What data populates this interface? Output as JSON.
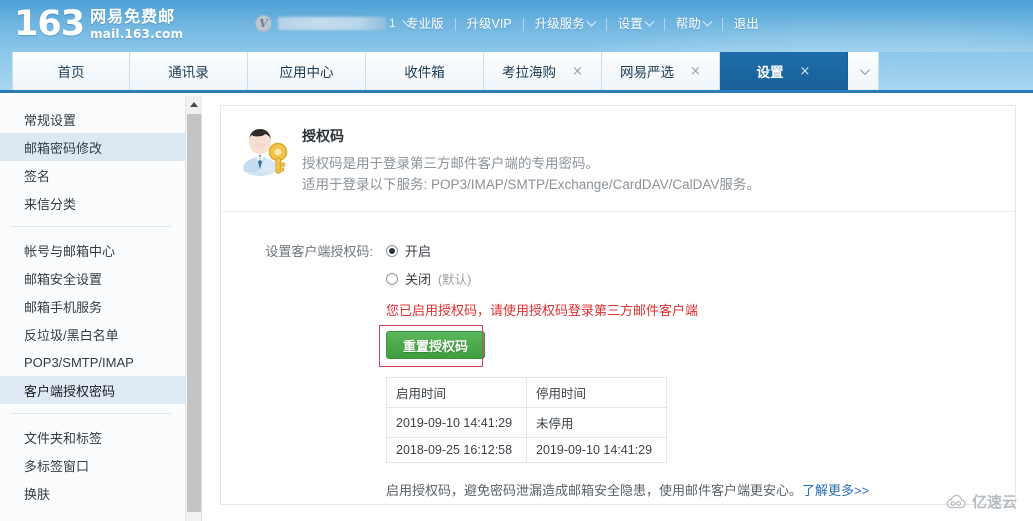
{
  "header": {
    "logo_number": "163",
    "logo_cn": "网易免费邮",
    "logo_url": "mail.163.com",
    "vip_badge": "V",
    "account_masked": "",
    "account_tail": "1",
    "nav": [
      {
        "label": "专业版",
        "has_caret": false
      },
      {
        "label": "升级VIP",
        "has_caret": false
      },
      {
        "label": "升级服务",
        "has_caret": true
      },
      {
        "label": "设置",
        "has_caret": true
      },
      {
        "label": "帮助",
        "has_caret": true
      },
      {
        "label": "退出",
        "has_caret": false
      }
    ]
  },
  "tabs": [
    {
      "label": "首页",
      "closable": false,
      "active": false
    },
    {
      "label": "通讯录",
      "closable": false,
      "active": false
    },
    {
      "label": "应用中心",
      "closable": false,
      "active": false
    },
    {
      "label": "收件箱",
      "closable": false,
      "active": false
    },
    {
      "label": "考拉海购",
      "closable": true,
      "active": false,
      "close": "×"
    },
    {
      "label": "网易严选",
      "closable": true,
      "active": false,
      "close": "×"
    },
    {
      "label": "设置",
      "closable": true,
      "active": true,
      "close": "×"
    }
  ],
  "sidebar": {
    "group1": [
      {
        "label": "常规设置",
        "state": "normal"
      },
      {
        "label": "邮箱密码修改",
        "state": "hover"
      },
      {
        "label": "签名",
        "state": "normal"
      },
      {
        "label": "来信分类",
        "state": "normal"
      }
    ],
    "group2": [
      {
        "label": "帐号与邮箱中心",
        "state": "normal"
      },
      {
        "label": "邮箱安全设置",
        "state": "normal"
      },
      {
        "label": "邮箱手机服务",
        "state": "normal"
      },
      {
        "label": "反垃圾/黑白名单",
        "state": "normal"
      },
      {
        "label": "POP3/SMTP/IMAP",
        "state": "normal"
      },
      {
        "label": "客户端授权密码",
        "state": "selected"
      }
    ],
    "group3": [
      {
        "label": "文件夹和标签",
        "state": "normal"
      },
      {
        "label": "多标签窗口",
        "state": "normal"
      },
      {
        "label": "换肤",
        "state": "normal"
      }
    ]
  },
  "main": {
    "title": "授权码",
    "desc_line1": "授权码是用于登录第三方邮件客户端的专用密码。",
    "desc_line2": "适用于登录以下服务: POP3/IMAP/SMTP/Exchange/CardDAV/CalDAV服务。",
    "form_label": "设置客户端授权码:",
    "radio_on": "开启",
    "radio_off": "关闭",
    "radio_off_note": "(默认)",
    "selected_option": "开启",
    "warning": "您已启用授权码，请使用授权码登录第三方邮件客户端",
    "reset_button": "重置授权码",
    "table": {
      "headers": [
        "启用时间",
        "停用时间"
      ],
      "rows": [
        [
          "2019-09-10 14:41:29",
          "未停用"
        ],
        [
          "2018-09-25 16:12:58",
          "2019-09-10 14:41:29"
        ]
      ]
    },
    "footer_text": "启用授权码，避免密码泄漏造成邮箱安全隐患，使用邮件客户端更安心。",
    "footer_link": "了解更多>>"
  },
  "watermark": {
    "text": "亿速云"
  },
  "colors": {
    "header_blue": "#63aedd",
    "active_tab": "#1c6da9",
    "accent_green": "#4aa94a",
    "warning_red": "#e03030",
    "annotation_red": "#d2435c",
    "link_blue": "#2a6fb5",
    "sidebar_selected": "#dfeaf4"
  }
}
